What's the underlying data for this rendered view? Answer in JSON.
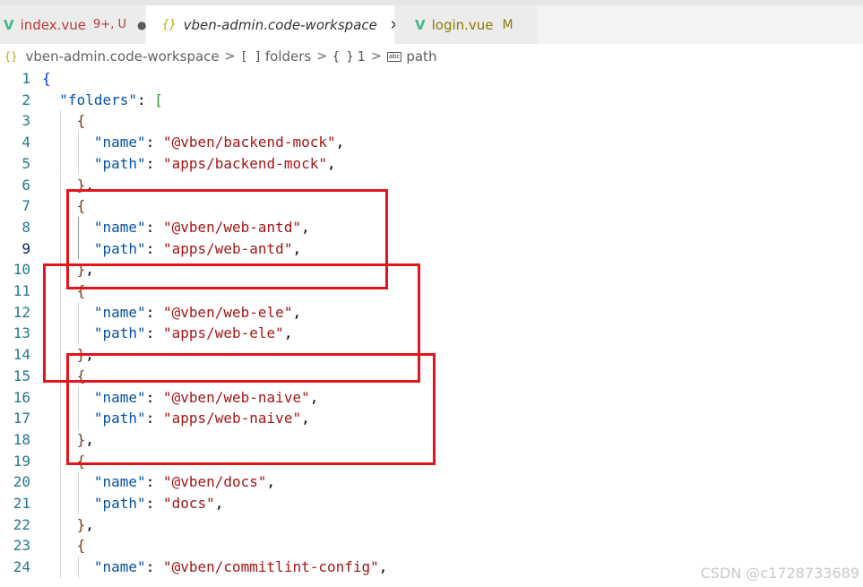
{
  "tabs": [
    {
      "label": "index.vue",
      "status": "9+, U",
      "modified_dot": "●",
      "icon": "vue-icon"
    },
    {
      "label": "vben-admin.code-workspace",
      "close": "✕",
      "icon": "json-braces-icon"
    },
    {
      "label": "login.vue",
      "status": "M",
      "icon": "vue-icon"
    }
  ],
  "breadcrumb": {
    "file": "vben-admin.code-workspace",
    "folders": "folders",
    "index": "1",
    "field": "path",
    "array_symbol": "[ ]",
    "object_symbol": "{ }",
    "string_symbol": "abc"
  },
  "editor": {
    "lines": [
      {
        "n": "1",
        "t": "{"
      },
      {
        "n": "2",
        "k": "\"folders\"",
        "p": ": ",
        "t": "["
      },
      {
        "n": "3",
        "t": "{"
      },
      {
        "n": "4",
        "k": "\"name\"",
        "p": ": ",
        "v": "\"@vben/backend-mock\"",
        "e": ","
      },
      {
        "n": "5",
        "k": "\"path\"",
        "p": ": ",
        "v": "\"apps/backend-mock\"",
        "e": ","
      },
      {
        "n": "6",
        "t": "}",
        "e": ","
      },
      {
        "n": "7",
        "t": "{"
      },
      {
        "n": "8",
        "k": "\"name\"",
        "p": ": ",
        "v": "\"@vben/web-antd\"",
        "e": ","
      },
      {
        "n": "9",
        "k": "\"path\"",
        "p": ": ",
        "v": "\"apps/web-antd\"",
        "e": ","
      },
      {
        "n": "10",
        "t": "}",
        "e": ","
      },
      {
        "n": "11",
        "t": "{"
      },
      {
        "n": "12",
        "k": "\"name\"",
        "p": ": ",
        "v": "\"@vben/web-ele\"",
        "e": ","
      },
      {
        "n": "13",
        "k": "\"path\"",
        "p": ": ",
        "v": "\"apps/web-ele\"",
        "e": ","
      },
      {
        "n": "14",
        "t": "}",
        "e": ","
      },
      {
        "n": "15",
        "t": "{"
      },
      {
        "n": "16",
        "k": "\"name\"",
        "p": ": ",
        "v": "\"@vben/web-naive\"",
        "e": ","
      },
      {
        "n": "17",
        "k": "\"path\"",
        "p": ": ",
        "v": "\"apps/web-naive\"",
        "e": ","
      },
      {
        "n": "18",
        "t": "}",
        "e": ","
      },
      {
        "n": "19",
        "t": "{"
      },
      {
        "n": "20",
        "k": "\"name\"",
        "p": ": ",
        "v": "\"@vben/docs\"",
        "e": ","
      },
      {
        "n": "21",
        "k": "\"path\"",
        "p": ": ",
        "v": "\"docs\"",
        "e": ","
      },
      {
        "n": "22",
        "t": "}",
        "e": ","
      },
      {
        "n": "23",
        "t": "{"
      },
      {
        "n": "24",
        "k": "\"name\"",
        "p": ": ",
        "v": "\"@vben/commitlint-config\"",
        "e": ","
      }
    ],
    "current_line": "9"
  },
  "watermark": "CSDN @c1728733689",
  "colors": {
    "key": "#0451a5",
    "string": "#a31515",
    "line_number": "#237893",
    "highlight_box": "#e1161c",
    "vue_icon": "#41b883"
  }
}
